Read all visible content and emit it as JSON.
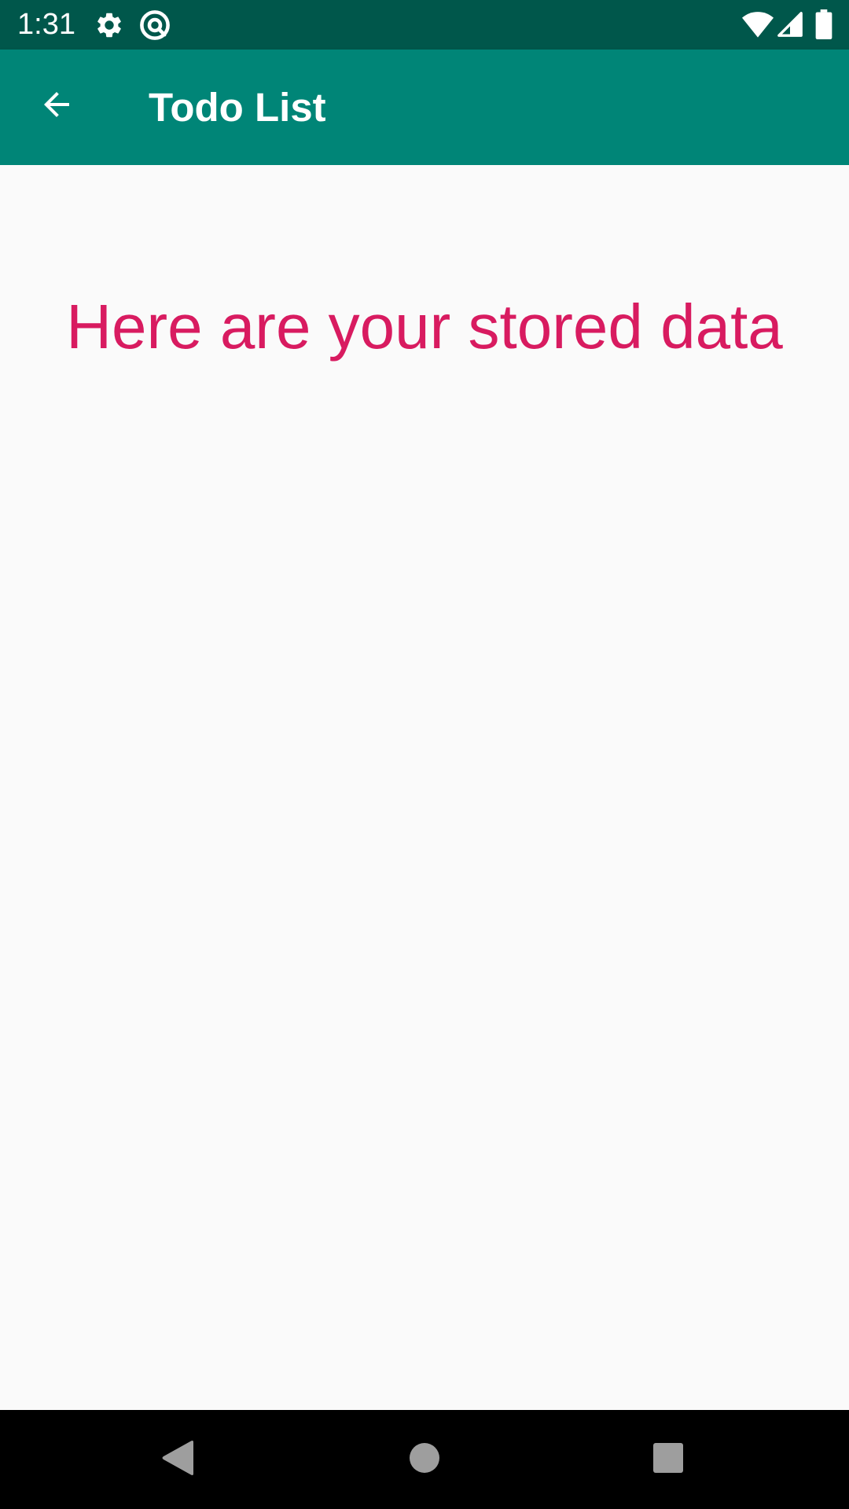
{
  "status_bar": {
    "time": "1:31",
    "icons": [
      "settings-icon",
      "at-sign-icon",
      "wifi-icon",
      "cellular-signal-icon",
      "battery-icon"
    ]
  },
  "app_bar": {
    "title": "Todo List",
    "back_icon": "arrow-back-icon"
  },
  "content": {
    "heading": "Here are your stored data"
  },
  "nav_bar": {
    "buttons": [
      "back-triangle-icon",
      "home-circle-icon",
      "recents-square-icon"
    ]
  },
  "colors": {
    "status_bar": "#00574b",
    "app_bar": "#008577",
    "accent": "#d81b60",
    "background": "#fafafa"
  }
}
